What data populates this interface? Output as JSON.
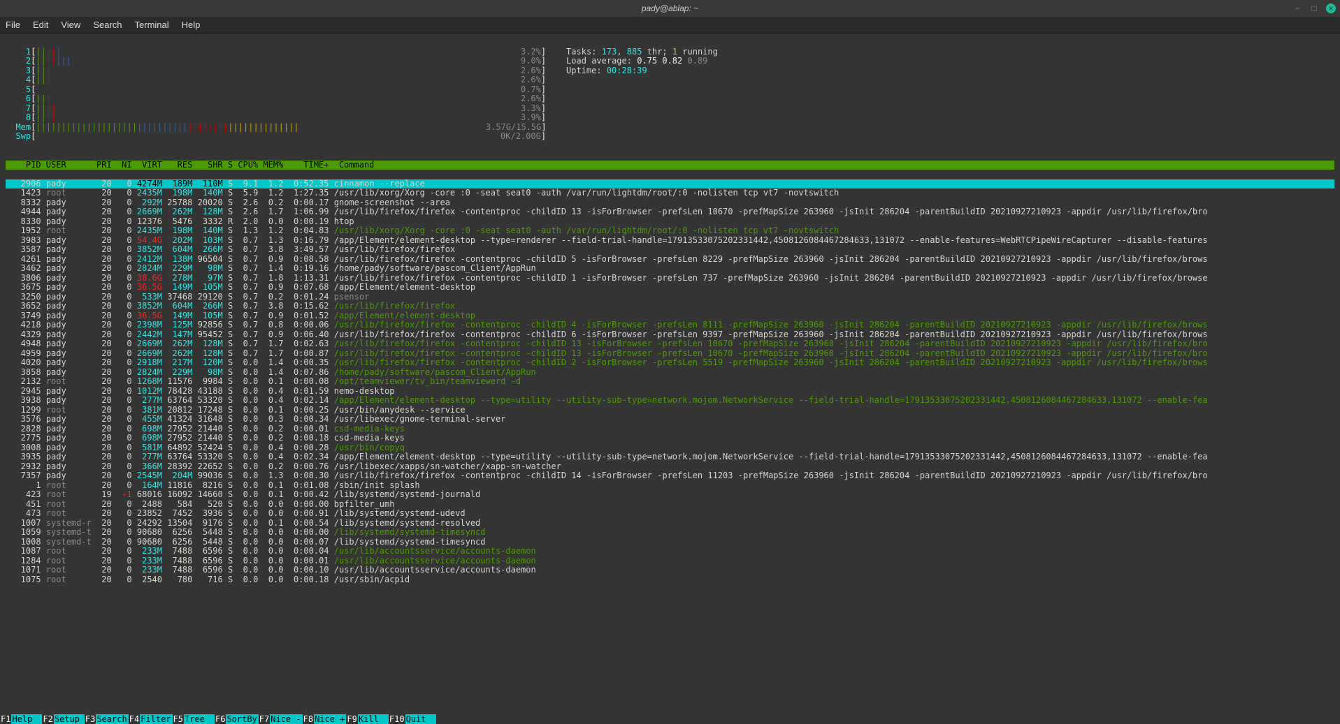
{
  "window": {
    "title": "pady@ablap: ~"
  },
  "menubar": [
    "File",
    "Edit",
    "View",
    "Search",
    "Terminal",
    "Help"
  ],
  "cpu_cores": [
    {
      "n": "1",
      "bar": "|||||",
      "pct": "3.2%"
    },
    {
      "n": "2",
      "bar": "|||||||",
      "pct": "9.0%"
    },
    {
      "n": "3",
      "bar": "|||",
      "pct": "2.6%"
    },
    {
      "n": "4",
      "bar": "|||",
      "pct": "2.6%"
    },
    {
      "n": "5",
      "bar": "",
      "pct": "0.7%"
    },
    {
      "n": "6",
      "bar": "|||",
      "pct": "2.6%"
    },
    {
      "n": "7",
      "bar": "||||",
      "pct": "3.3%"
    },
    {
      "n": "8",
      "bar": "||||",
      "pct": "3.9%"
    }
  ],
  "mem": {
    "label": "Mem",
    "bar": "||||||||||||||||||||||||||||||||||||||||||||||||||||",
    "used": "3.57G",
    "total": "15.5G"
  },
  "swp": {
    "label": "Swp",
    "bar": "",
    "used": "0K",
    "total": "2.00G"
  },
  "tasks": {
    "label": "Tasks:",
    "procs": "173",
    "threads": "885",
    "thr_lbl": "thr;",
    "running": "1",
    "run_lbl": "running"
  },
  "load": {
    "label": "Load average:",
    "l1": "0.75",
    "l2": "0.82",
    "l3": "0.89"
  },
  "uptime": {
    "label": "Uptime:",
    "value": "00:28:39"
  },
  "columns": {
    "PID": "PID",
    "USER": "USER",
    "PRI": "PRI",
    "NI": "NI",
    "VIRT": "VIRT",
    "RES": "RES",
    "SHR": "SHR",
    "S": "S",
    "CPU": "CPU%",
    "MEM": "MEM%",
    "TIME": "TIME+",
    "CMD": "Command"
  },
  "rows": [
    {
      "pid": "2906",
      "user": "pady",
      "pri": "20",
      "ni": "0",
      "virt": "4274M",
      "res": "189M",
      "shr": "110M",
      "s": "S",
      "cpu": "9.1",
      "mem": "1.2",
      "time": "0:52.35",
      "cmd": "cinnamon --replace",
      "sel": true
    },
    {
      "pid": "1423",
      "user": "root",
      "pri": "20",
      "ni": "0",
      "virt": "2435M",
      "res": "198M",
      "shr": "140M",
      "s": "S",
      "cpu": "5.9",
      "mem": "1.2",
      "time": "1:27.35",
      "cmd": "/usr/lib/xorg/Xorg -core :0 -seat seat0 -auth /var/run/lightdm/root/:0 -nolisten tcp vt7 -novtswitch",
      "dim": false
    },
    {
      "pid": "8332",
      "user": "pady",
      "pri": "20",
      "ni": "0",
      "virt": "292M",
      "res": "25788",
      "shr": "20020",
      "s": "S",
      "cpu": "2.6",
      "mem": "0.2",
      "time": "0:00.17",
      "cmd": "gnome-screenshot --area"
    },
    {
      "pid": "4944",
      "user": "pady",
      "pri": "20",
      "ni": "0",
      "virt": "2669M",
      "res": "262M",
      "shr": "128M",
      "s": "S",
      "cpu": "2.6",
      "mem": "1.7",
      "time": "1:06.99",
      "cmd": "/usr/lib/firefox/firefox -contentproc -childID 13 -isForBrowser -prefsLen 10670 -prefMapSize 263960 -jsInit 286204 -parentBuildID 20210927210923 -appdir /usr/lib/firefox/bro"
    },
    {
      "pid": "8330",
      "user": "pady",
      "pri": "20",
      "ni": "0",
      "virt": "12376",
      "res": "5476",
      "shr": "3332",
      "s": "R",
      "cpu": "2.0",
      "mem": "0.0",
      "time": "0:00.19",
      "cmd": "htop"
    },
    {
      "pid": "1952",
      "user": "root",
      "pri": "20",
      "ni": "0",
      "virt": "2435M",
      "res": "198M",
      "shr": "140M",
      "s": "S",
      "cpu": "1.3",
      "mem": "1.2",
      "time": "0:04.83",
      "cmd": "/usr/lib/xorg/Xorg -core :0 -seat seat0 -auth /var/run/lightdm/root/:0 -nolisten tcp vt7 -novtswitch",
      "dim": true
    },
    {
      "pid": "3983",
      "user": "pady",
      "pri": "20",
      "ni": "0",
      "virt": "54.4G",
      "virtRed": true,
      "res": "202M",
      "shr": "103M",
      "s": "S",
      "cpu": "0.7",
      "mem": "1.3",
      "time": "0:16.79",
      "cmd": "/app/Element/element-desktop --type=renderer --field-trial-handle=17913533075202331442,4508126084467284633,131072 --enable-features=WebRTCPipeWireCapturer --disable-features"
    },
    {
      "pid": "3587",
      "user": "pady",
      "pri": "20",
      "ni": "0",
      "virt": "3852M",
      "res": "604M",
      "shr": "266M",
      "s": "S",
      "cpu": "0.7",
      "mem": "3.8",
      "time": "3:49.57",
      "cmd": "/usr/lib/firefox/firefox"
    },
    {
      "pid": "4261",
      "user": "pady",
      "pri": "20",
      "ni": "0",
      "virt": "2412M",
      "res": "138M",
      "shr": "96504",
      "s": "S",
      "cpu": "0.7",
      "mem": "0.9",
      "time": "0:08.58",
      "cmd": "/usr/lib/firefox/firefox -contentproc -childID 5 -isForBrowser -prefsLen 8229 -prefMapSize 263960 -jsInit 286204 -parentBuildID 20210927210923 -appdir /usr/lib/firefox/brows"
    },
    {
      "pid": "3462",
      "user": "pady",
      "pri": "20",
      "ni": "0",
      "virt": "2824M",
      "res": "229M",
      "shr": "98M",
      "s": "S",
      "cpu": "0.7",
      "mem": "1.4",
      "time": "0:19.16",
      "cmd": "/home/pady/software/pascom_Client/AppRun"
    },
    {
      "pid": "3806",
      "user": "pady",
      "pri": "20",
      "ni": "0",
      "virt": "38.6G",
      "virtRed": true,
      "res": "278M",
      "shr": "97M",
      "s": "S",
      "cpu": "0.7",
      "mem": "1.8",
      "time": "1:13.31",
      "cmd": "/usr/lib/firefox/firefox -contentproc -childID 1 -isForBrowser -prefsLen 737 -prefMapSize 263960 -jsInit 286204 -parentBuildID 20210927210923 -appdir /usr/lib/firefox/browse"
    },
    {
      "pid": "3675",
      "user": "pady",
      "pri": "20",
      "ni": "0",
      "virt": "36.5G",
      "virtRed": true,
      "res": "149M",
      "shr": "105M",
      "s": "S",
      "cpu": "0.7",
      "mem": "0.9",
      "time": "0:07.68",
      "cmd": "/app/Element/element-desktop"
    },
    {
      "pid": "3250",
      "user": "pady",
      "pri": "20",
      "ni": "0",
      "virt": "533M",
      "res": "37468",
      "shr": "29120",
      "s": "S",
      "cpu": "0.7",
      "mem": "0.2",
      "time": "0:01.24",
      "cmd": "psensor",
      "cmdDim": true
    },
    {
      "pid": "3652",
      "user": "pady",
      "pri": "20",
      "ni": "0",
      "virt": "3852M",
      "res": "604M",
      "shr": "266M",
      "s": "S",
      "cpu": "0.7",
      "mem": "3.8",
      "time": "0:15.62",
      "cmd": "/usr/lib/firefox/firefox",
      "dim": true
    },
    {
      "pid": "3749",
      "user": "pady",
      "pri": "20",
      "ni": "0",
      "virt": "36.5G",
      "virtRed": true,
      "res": "149M",
      "shr": "105M",
      "s": "S",
      "cpu": "0.7",
      "mem": "0.9",
      "time": "0:01.52",
      "cmd": "/app/Element/element-desktop",
      "dim": true
    },
    {
      "pid": "4218",
      "user": "pady",
      "pri": "20",
      "ni": "0",
      "virt": "2398M",
      "res": "125M",
      "shr": "92856",
      "s": "S",
      "cpu": "0.7",
      "mem": "0.8",
      "time": "0:00.06",
      "cmd": "/usr/lib/firefox/firefox -contentproc -childID 4 -isForBrowser -prefsLen 8111 -prefMapSize 263960 -jsInit 286204 -parentBuildID 20210927210923 -appdir /usr/lib/firefox/brows",
      "dim": true
    },
    {
      "pid": "4329",
      "user": "pady",
      "pri": "20",
      "ni": "0",
      "virt": "2442M",
      "res": "147M",
      "shr": "95452",
      "s": "S",
      "cpu": "0.7",
      "mem": "0.9",
      "time": "0:06.40",
      "cmd": "/usr/lib/firefox/firefox -contentproc -childID 6 -isForBrowser -prefsLen 9397 -prefMapSize 263960 -jsInit 286204 -parentBuildID 20210927210923 -appdir /usr/lib/firefox/brows"
    },
    {
      "pid": "4948",
      "user": "pady",
      "pri": "20",
      "ni": "0",
      "virt": "2669M",
      "res": "262M",
      "shr": "128M",
      "s": "S",
      "cpu": "0.7",
      "mem": "1.7",
      "time": "0:02.63",
      "cmd": "/usr/lib/firefox/firefox -contentproc -childID 13 -isForBrowser -prefsLen 10670 -prefMapSize 263960 -jsInit 286204 -parentBuildID 20210927210923 -appdir /usr/lib/firefox/bro",
      "dim": true
    },
    {
      "pid": "4959",
      "user": "pady",
      "pri": "20",
      "ni": "0",
      "virt": "2669M",
      "res": "262M",
      "shr": "128M",
      "s": "S",
      "cpu": "0.7",
      "mem": "1.7",
      "time": "0:00.87",
      "cmd": "/usr/lib/firefox/firefox -contentproc -childID 13 -isForBrowser -prefsLen 10670 -prefMapSize 263960 -jsInit 286204 -parentBuildID 20210927210923 -appdir /usr/lib/firefox/bro",
      "dim": true
    },
    {
      "pid": "4020",
      "user": "pady",
      "pri": "20",
      "ni": "0",
      "virt": "2918M",
      "res": "217M",
      "shr": "120M",
      "s": "S",
      "cpu": "0.0",
      "mem": "1.4",
      "time": "0:00.35",
      "cmd": "/usr/lib/firefox/firefox -contentproc -childID 2 -isForBrowser -prefsLen 5519 -prefMapSize 263960 -jsInit 286204 -parentBuildID 20210927210923 -appdir /usr/lib/firefox/brows",
      "dim": true
    },
    {
      "pid": "3858",
      "user": "pady",
      "pri": "20",
      "ni": "0",
      "virt": "2824M",
      "res": "229M",
      "shr": "98M",
      "s": "S",
      "cpu": "0.0",
      "mem": "1.4",
      "time": "0:07.86",
      "cmd": "/home/pady/software/pascom_Client/AppRun",
      "dim": true
    },
    {
      "pid": "2132",
      "user": "root",
      "pri": "20",
      "ni": "0",
      "virt": "1268M",
      "res": "11576",
      "shr": "9984",
      "s": "S",
      "cpu": "0.0",
      "mem": "0.1",
      "time": "0:00.08",
      "cmd": "/opt/teamviewer/tv_bin/teamviewerd -d",
      "dim": true
    },
    {
      "pid": "2945",
      "user": "pady",
      "pri": "20",
      "ni": "0",
      "virt": "1012M",
      "res": "78428",
      "shr": "43188",
      "s": "S",
      "cpu": "0.0",
      "mem": "0.4",
      "time": "0:01.59",
      "cmd": "nemo-desktop"
    },
    {
      "pid": "3938",
      "user": "pady",
      "pri": "20",
      "ni": "0",
      "virt": "277M",
      "res": "63764",
      "shr": "53320",
      "s": "S",
      "cpu": "0.0",
      "mem": "0.4",
      "time": "0:02.14",
      "cmd": "/app/Element/element-desktop --type=utility --utility-sub-type=network.mojom.NetworkService --field-trial-handle=17913533075202331442,4508126084467284633,131072 --enable-fea",
      "dim": true
    },
    {
      "pid": "1299",
      "user": "root",
      "pri": "20",
      "ni": "0",
      "virt": "381M",
      "res": "20812",
      "shr": "17248",
      "s": "S",
      "cpu": "0.0",
      "mem": "0.1",
      "time": "0:00.25",
      "cmd": "/usr/bin/anydesk --service"
    },
    {
      "pid": "3576",
      "user": "pady",
      "pri": "20",
      "ni": "0",
      "virt": "455M",
      "res": "41324",
      "shr": "31648",
      "s": "S",
      "cpu": "0.0",
      "mem": "0.3",
      "time": "0:00.34",
      "cmd": "/usr/libexec/gnome-terminal-server"
    },
    {
      "pid": "2828",
      "user": "pady",
      "pri": "20",
      "ni": "0",
      "virt": "698M",
      "res": "27952",
      "shr": "21440",
      "s": "S",
      "cpu": "0.0",
      "mem": "0.2",
      "time": "0:00.01",
      "cmd": "csd-media-keys",
      "dim": true
    },
    {
      "pid": "2775",
      "user": "pady",
      "pri": "20",
      "ni": "0",
      "virt": "698M",
      "res": "27952",
      "shr": "21440",
      "s": "S",
      "cpu": "0.0",
      "mem": "0.2",
      "time": "0:00.18",
      "cmd": "csd-media-keys"
    },
    {
      "pid": "3008",
      "user": "pady",
      "pri": "20",
      "ni": "0",
      "virt": "581M",
      "res": "64892",
      "shr": "52424",
      "s": "S",
      "cpu": "0.0",
      "mem": "0.4",
      "time": "0:00.28",
      "cmd": "/usr/bin/copyq",
      "dim": true
    },
    {
      "pid": "3935",
      "user": "pady",
      "pri": "20",
      "ni": "0",
      "virt": "277M",
      "res": "63764",
      "shr": "53320",
      "s": "S",
      "cpu": "0.0",
      "mem": "0.4",
      "time": "0:02.34",
      "cmd": "/app/Element/element-desktop --type=utility --utility-sub-type=network.mojom.NetworkService --field-trial-handle=17913533075202331442,4508126084467284633,131072 --enable-fea"
    },
    {
      "pid": "2932",
      "user": "pady",
      "pri": "20",
      "ni": "0",
      "virt": "366M",
      "res": "28392",
      "shr": "22652",
      "s": "S",
      "cpu": "0.0",
      "mem": "0.2",
      "time": "0:00.76",
      "cmd": "/usr/libexec/xapps/sn-watcher/xapp-sn-watcher"
    },
    {
      "pid": "7357",
      "user": "pady",
      "pri": "20",
      "ni": "0",
      "virt": "2545M",
      "res": "204M",
      "shr": "99036",
      "s": "S",
      "cpu": "0.0",
      "mem": "1.3",
      "time": "0:08.30",
      "cmd": "/usr/lib/firefox/firefox -contentproc -childID 14 -isForBrowser -prefsLen 11203 -prefMapSize 263960 -jsInit 286204 -parentBuildID 20210927210923 -appdir /usr/lib/firefox/bro"
    },
    {
      "pid": "1",
      "user": "root",
      "pri": "20",
      "ni": "0",
      "virt": "164M",
      "res": "11816",
      "shr": "8216",
      "s": "S",
      "cpu": "0.0",
      "mem": "0.1",
      "time": "0:01.08",
      "cmd": "/sbin/init splash"
    },
    {
      "pid": "423",
      "user": "root",
      "pri": "19",
      "ni": "-1",
      "niRed": true,
      "virt": "68016",
      "res": "16092",
      "shr": "14660",
      "s": "S",
      "cpu": "0.0",
      "mem": "0.1",
      "time": "0:00.42",
      "cmd": "/lib/systemd/systemd-journald"
    },
    {
      "pid": "451",
      "user": "root",
      "pri": "20",
      "ni": "0",
      "virt": "2488",
      "res": "584",
      "shr": "520",
      "s": "S",
      "cpu": "0.0",
      "mem": "0.0",
      "time": "0:00.00",
      "cmd": "bpfilter_umh"
    },
    {
      "pid": "473",
      "user": "root",
      "pri": "20",
      "ni": "0",
      "virt": "23852",
      "res": "7452",
      "shr": "3936",
      "s": "S",
      "cpu": "0.0",
      "mem": "0.0",
      "time": "0:00.91",
      "cmd": "/lib/systemd/systemd-udevd"
    },
    {
      "pid": "1007",
      "user": "systemd-r",
      "pri": "20",
      "ni": "0",
      "virt": "24292",
      "res": "13504",
      "shr": "9176",
      "s": "S",
      "cpu": "0.0",
      "mem": "0.1",
      "time": "0:00.54",
      "cmd": "/lib/systemd/systemd-resolved"
    },
    {
      "pid": "1059",
      "user": "systemd-t",
      "pri": "20",
      "ni": "0",
      "virt": "90680",
      "res": "6256",
      "shr": "5448",
      "s": "S",
      "cpu": "0.0",
      "mem": "0.0",
      "time": "0:00.00",
      "cmd": "/lib/systemd/systemd-timesyncd",
      "dim": true
    },
    {
      "pid": "1008",
      "user": "systemd-t",
      "pri": "20",
      "ni": "0",
      "virt": "90680",
      "res": "6256",
      "shr": "5448",
      "s": "S",
      "cpu": "0.0",
      "mem": "0.0",
      "time": "0:00.07",
      "cmd": "/lib/systemd/systemd-timesyncd"
    },
    {
      "pid": "1087",
      "user": "root",
      "pri": "20",
      "ni": "0",
      "virt": "233M",
      "res": "7488",
      "shr": "6596",
      "s": "S",
      "cpu": "0.0",
      "mem": "0.0",
      "time": "0:00.04",
      "cmd": "/usr/lib/accountsservice/accounts-daemon",
      "dim": true
    },
    {
      "pid": "1284",
      "user": "root",
      "pri": "20",
      "ni": "0",
      "virt": "233M",
      "res": "7488",
      "shr": "6596",
      "s": "S",
      "cpu": "0.0",
      "mem": "0.0",
      "time": "0:00.01",
      "cmd": "/usr/lib/accountsservice/accounts-daemon",
      "dim": true
    },
    {
      "pid": "1071",
      "user": "root",
      "pri": "20",
      "ni": "0",
      "virt": "233M",
      "res": "7488",
      "shr": "6596",
      "s": "S",
      "cpu": "0.0",
      "mem": "0.0",
      "time": "0:00.10",
      "cmd": "/usr/lib/accountsservice/accounts-daemon"
    },
    {
      "pid": "1075",
      "user": "root",
      "pri": "20",
      "ni": "0",
      "virt": "2540",
      "res": "780",
      "shr": "716",
      "s": "S",
      "cpu": "0.0",
      "mem": "0.0",
      "time": "0:00.18",
      "cmd": "/usr/sbin/acpid"
    }
  ],
  "fkeys": [
    {
      "k": "F1",
      "l": "Help"
    },
    {
      "k": "F2",
      "l": "Setup"
    },
    {
      "k": "F3",
      "l": "Search"
    },
    {
      "k": "F4",
      "l": "Filter"
    },
    {
      "k": "F5",
      "l": "Tree"
    },
    {
      "k": "F6",
      "l": "SortBy"
    },
    {
      "k": "F7",
      "l": "Nice -"
    },
    {
      "k": "F8",
      "l": "Nice +"
    },
    {
      "k": "F9",
      "l": "Kill"
    },
    {
      "k": "F10",
      "l": "Quit"
    }
  ]
}
